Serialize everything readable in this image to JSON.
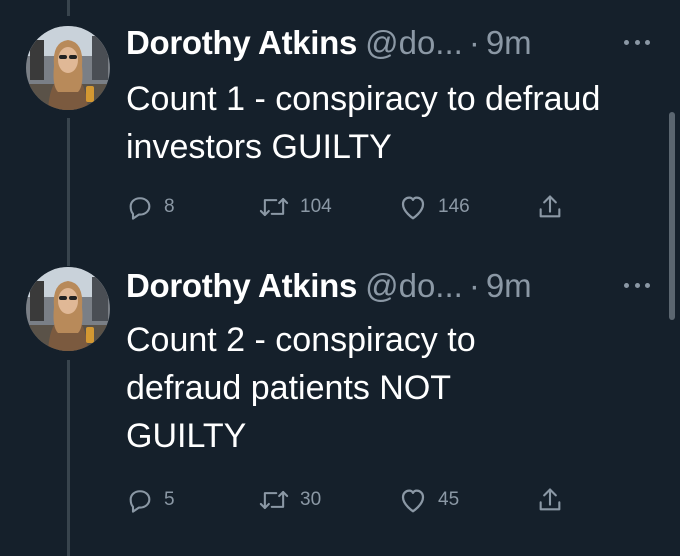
{
  "tweets": [
    {
      "author_name": "Dorothy Atkins",
      "handle": "@do...",
      "separator": "·",
      "time": "9m",
      "text": "Count 1 - conspiracy to defraud investors GUILTY",
      "replies": "8",
      "retweets": "104",
      "likes": "146"
    },
    {
      "author_name": "Dorothy Atkins",
      "handle": "@do...",
      "separator": "·",
      "time": "9m",
      "text": "Count 2 - conspiracy to defraud patients NOT GUILTY",
      "replies": "5",
      "retweets": "30",
      "likes": "45"
    }
  ],
  "icons": {
    "reply": "reply-icon",
    "retweet": "retweet-icon",
    "like": "like-icon",
    "share": "share-icon",
    "more": "more-icon"
  },
  "colors": {
    "background": "#15202b",
    "primary_text": "#ffffff",
    "secondary_text": "#8b98a5",
    "thread_line": "#38444d"
  }
}
